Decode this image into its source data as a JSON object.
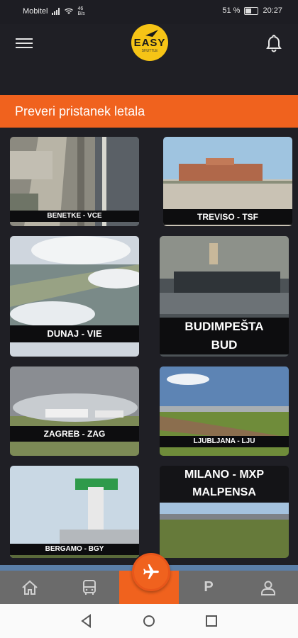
{
  "status_bar": {
    "carrier": "Mobitel",
    "net_speed_top": "46",
    "net_speed_bottom": "B/s",
    "battery": "51 %",
    "time": "20:27"
  },
  "header": {
    "logo_text": "EASY",
    "logo_sub": "SHUTTLE"
  },
  "banner": {
    "title": "Preveri pristanek letala"
  },
  "airports": [
    {
      "label": "BENETKE - VCE"
    },
    {
      "label": "TREVISO - TSF"
    },
    {
      "label": "DUNAJ - VIE"
    },
    {
      "label_line1": "BUDIMPEŠTA",
      "label_line2": "BUD"
    },
    {
      "label": "ZAGREB - ZAG"
    },
    {
      "label": "LJUBLJANA - LJU"
    },
    {
      "label": "BERGAMO - BGY"
    },
    {
      "label_line1": "MILANO - MXP",
      "label_line2": "MALPENSA"
    }
  ],
  "icons": {
    "menu": "hamburger-menu-icon",
    "bell": "bell-icon",
    "home": "home-icon",
    "bus": "bus-icon",
    "plane": "airplane-icon",
    "parking": "parking-icon",
    "profile": "person-icon"
  },
  "nav": {
    "parking_label": "P"
  },
  "colors": {
    "accent": "#f0621e",
    "background": "#1f1f25",
    "nav_bg": "#6b6b6b"
  }
}
